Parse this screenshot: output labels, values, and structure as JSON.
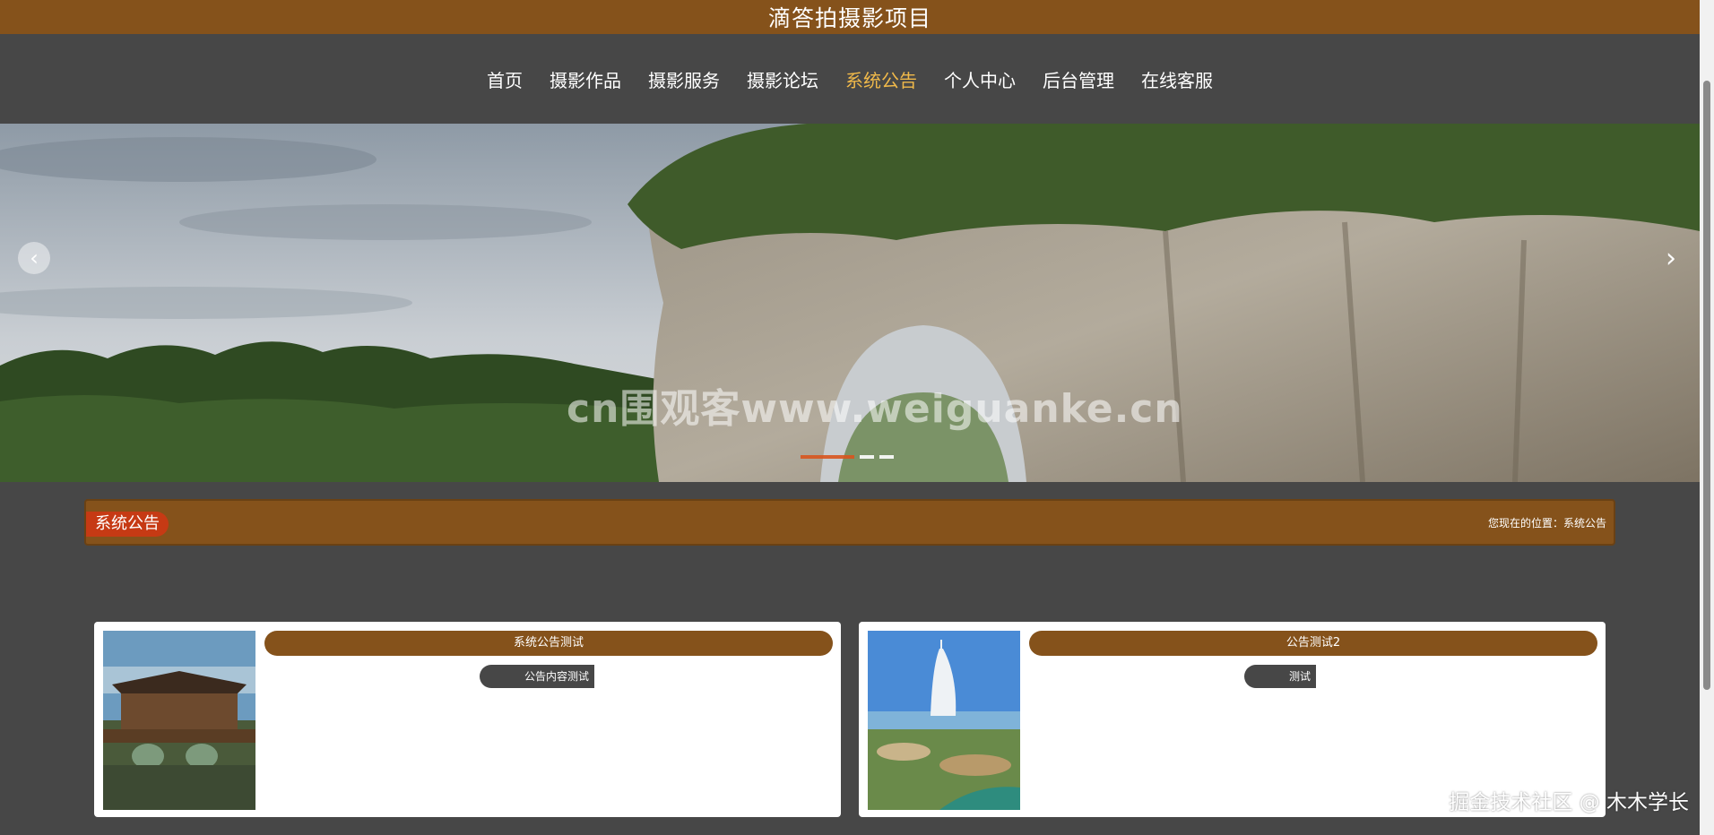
{
  "site_title": "滴答拍摄影项目",
  "nav": {
    "items": [
      {
        "label": "首页"
      },
      {
        "label": "摄影作品"
      },
      {
        "label": "摄影服务"
      },
      {
        "label": "摄影论坛"
      },
      {
        "label": "系统公告",
        "active": true
      },
      {
        "label": "个人中心"
      },
      {
        "label": "后台管理"
      },
      {
        "label": "在线客服"
      }
    ]
  },
  "banner": {
    "watermark": "cn围观客www.weiguanke.cn",
    "prev_icon": "chevron-left-icon",
    "next_icon": "chevron-right-icon"
  },
  "section": {
    "title": "系统公告",
    "breadcrumb": "您现在的位置：系统公告"
  },
  "notices": [
    {
      "title": "系统公告测试",
      "summary": "公告内容测试"
    },
    {
      "title": "公告测试2",
      "summary": "测试"
    }
  ],
  "footer_watermark": "掘金技术社区 @ 木木学长",
  "colors": {
    "brown": "#85521b",
    "background": "#474747",
    "active_nav": "#f0b94a",
    "tag_red": "#c63a14"
  }
}
